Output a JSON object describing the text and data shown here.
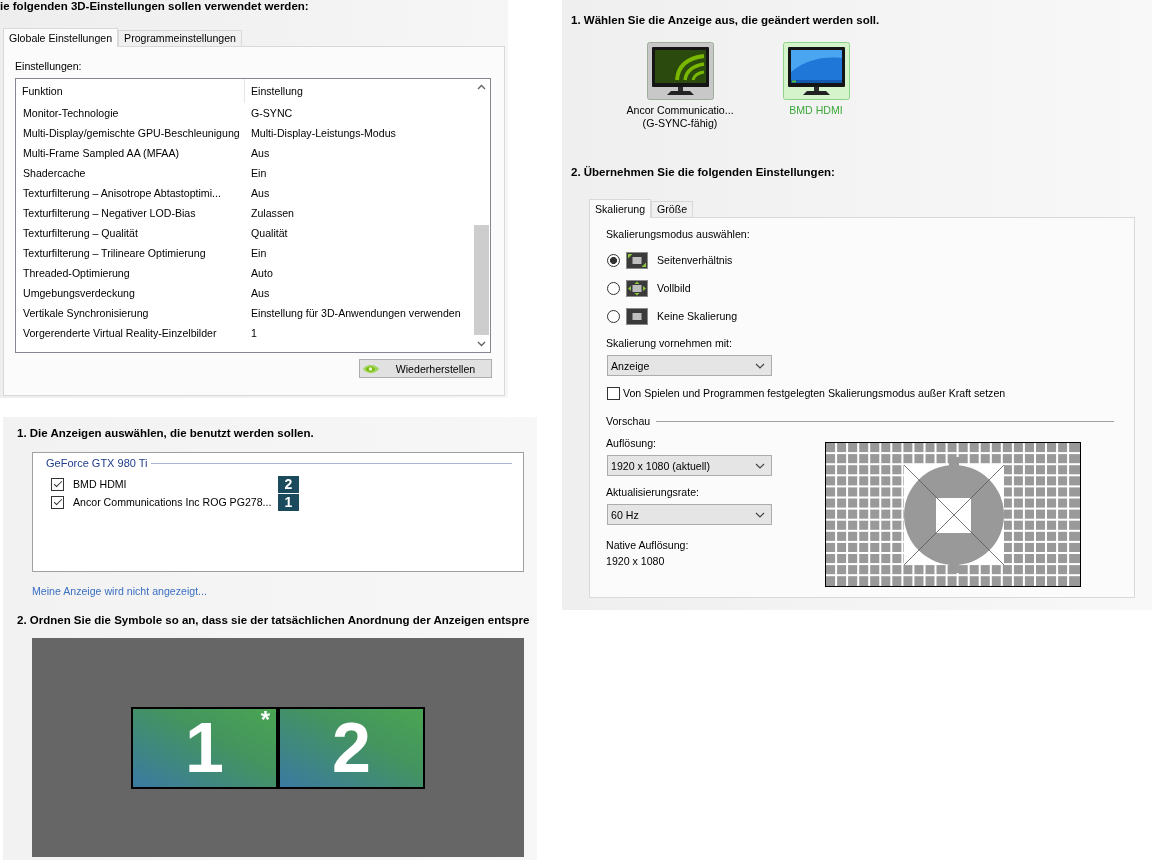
{
  "global_3d_settings": {
    "heading": "ie folgenden 3D-Einstellungen sollen verwendet werden:",
    "tabs": [
      {
        "label": "Globale Einstellungen",
        "selected": true
      },
      {
        "label": "Programmeinstellungen",
        "selected": false
      }
    ],
    "settings_label": "Einstellungen:",
    "columns": [
      "Funktion",
      "Einstellung"
    ],
    "rows": [
      {
        "feature": "Monitor-Technologie",
        "setting": "G-SYNC"
      },
      {
        "feature": "Multi-Display/gemischte GPU-Beschleunigung",
        "setting": "Multi-Display-Leistungs-Modus"
      },
      {
        "feature": "Multi-Frame Sampled AA (MFAA)",
        "setting": "Aus"
      },
      {
        "feature": "Shadercache",
        "setting": "Ein"
      },
      {
        "feature": "Texturfilterung – Anisotrope Abtastoptimi...",
        "setting": "Aus"
      },
      {
        "feature": "Texturfilterung – Negativer LOD-Bias",
        "setting": "Zulassen"
      },
      {
        "feature": "Texturfilterung – Qualität",
        "setting": "Qualität"
      },
      {
        "feature": "Texturfilterung – Trilineare Optimierung",
        "setting": "Ein"
      },
      {
        "feature": "Threaded-Optimierung",
        "setting": "Auto"
      },
      {
        "feature": "Umgebungsverdeckung",
        "setting": "Aus"
      },
      {
        "feature": "Vertikale Synchronisierung",
        "setting": "Einstellung für 3D-Anwendungen verwenden"
      },
      {
        "feature": "Vorgerenderte Virtual Reality-Einzelbilder",
        "setting": "1"
      }
    ],
    "restore_button": "Wiederherstellen"
  },
  "display_selection": {
    "heading": "1. Die Anzeigen auswählen, die benutzt werden sollen.",
    "group_title": "GeForce GTX 980 Ti",
    "displays": [
      {
        "label": "BMD HDMI",
        "checked": true,
        "badge": "2"
      },
      {
        "label": "Ancor Communications Inc ROG PG278...",
        "checked": true,
        "badge": "1"
      }
    ],
    "link": "Meine Anzeige wird nicht angezeigt...",
    "arrange_heading": "2. Ordnen Sie die Symbole so an, dass sie der tatsächlichen Anordnung der Anzeigen entspre",
    "arrangement": [
      {
        "number": "1",
        "marker": "*"
      },
      {
        "number": "2"
      }
    ]
  },
  "display_change": {
    "heading": "1. Wählen Sie die Anzeige aus, die geändert werden soll.",
    "displays": [
      {
        "kind": "gsync",
        "label": "Ancor Communicatio...",
        "sublabel": "(G-SYNC-fähig)",
        "selected": false
      },
      {
        "kind": "standard",
        "label": "BMD HDMI",
        "selected": true
      }
    ],
    "settings_heading": "2. Übernehmen Sie die folgenden Einstellungen:",
    "tabs": [
      {
        "label": "Skalierung",
        "selected": true
      },
      {
        "label": "Größe",
        "selected": false
      }
    ],
    "mode_label": "Skalierungsmodus auswählen:",
    "modes": [
      {
        "kind": "aspect",
        "label": "Seitenverhältnis",
        "selected": true
      },
      {
        "kind": "fullscreen",
        "label": "Vollbild",
        "selected": false
      },
      {
        "kind": "none",
        "label": "Keine Skalierung",
        "selected": false
      }
    ],
    "scale_with_label": "Skalierung vornehmen mit:",
    "scale_with_value": "Anzeige",
    "override": {
      "label": "Von Spielen und Programmen festgelegten Skalierungsmodus außer Kraft setzen",
      "checked": false
    },
    "preview_label": "Vorschau",
    "resolution_label": "Auflösung:",
    "resolution_value": "1920 x 1080 (aktuell)",
    "refresh_label": "Aktualisierungsrate:",
    "refresh_value": "60 Hz",
    "native_label": "Native Auflösung:",
    "native_value": "1920 x 1080"
  }
}
